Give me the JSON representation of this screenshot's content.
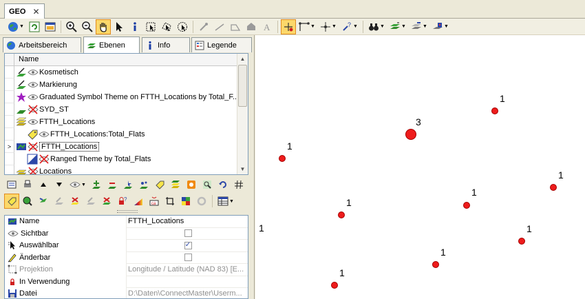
{
  "window": {
    "tab_title": "GEO",
    "close_glyph": "✕"
  },
  "toolbar": {
    "icons": [
      "globe-icon",
      "refresh-icon",
      "window-icon",
      "zoom-in-icon",
      "zoom-out-icon",
      "pan-hand-icon",
      "pointer-icon",
      "info-icon",
      "select-rect-icon",
      "select-polygon-icon",
      "select-radius-icon",
      "edit-node-icon",
      "line-icon",
      "rectangle-icon",
      "polygon-icon",
      "text-icon",
      "snap-icon",
      "measure-icon",
      "target-icon",
      "locate-icon",
      "binoculars-icon",
      "layer-add-icon",
      "layer-edit-icon",
      "layer-settings-icon"
    ],
    "active": "snap-icon"
  },
  "panel_tabs": [
    {
      "label": "Arbeitsbereich",
      "icon": "workspace-icon"
    },
    {
      "label": "Ebenen",
      "icon": "layers-icon",
      "selected": true
    },
    {
      "label": "Info",
      "icon": "info-icon"
    },
    {
      "label": "Legende",
      "icon": "legend-icon"
    }
  ],
  "layers": {
    "header": "Name",
    "rows": [
      {
        "label": "Kosmetisch",
        "indent": 0,
        "type": "cosmetic",
        "visible": true
      },
      {
        "label": "Markierung",
        "indent": 0,
        "type": "cosmetic",
        "visible": true
      },
      {
        "label": "Graduated Symbol Theme on FTTH_Locations by Total_F...",
        "indent": 0,
        "type": "theme-star",
        "visible": true
      },
      {
        "label": "SYD_ST",
        "indent": 0,
        "type": "region",
        "visible": false
      },
      {
        "label": "FTTH_Locations",
        "indent": 0,
        "type": "stack",
        "visible": true
      },
      {
        "label": "FTTH_Locations:Total_Flats",
        "indent": 1,
        "type": "label-tag",
        "visible": true
      },
      {
        "label": "FTTH_Locations",
        "indent": 0,
        "type": "table",
        "visible": false,
        "selected": true,
        "marker": ">"
      },
      {
        "label": "Ranged Theme by Total_Flats",
        "indent": 1,
        "type": "ranged",
        "visible": false
      },
      {
        "label": "Locations",
        "indent": 0,
        "type": "stack",
        "visible": false
      }
    ]
  },
  "properties": [
    {
      "key": "Name",
      "value": "FTTH_Locations",
      "icon": "layer-icon",
      "kind": "text"
    },
    {
      "key": "Sichtbar",
      "value": "",
      "icon": "eye-icon",
      "kind": "checkbox",
      "checked": false
    },
    {
      "key": "Auswählbar",
      "value": "",
      "icon": "select-arrow-icon",
      "kind": "checkbox",
      "checked": true
    },
    {
      "key": "Änderbar",
      "value": "",
      "icon": "pencil-icon",
      "kind": "checkbox",
      "checked": false
    },
    {
      "key": "Projektion",
      "value": "Longitude / Latitude (NAD 83) [E...",
      "icon": "projection-icon",
      "kind": "text",
      "disabled": true
    },
    {
      "key": "In Verwendung",
      "value": "",
      "icon": "lock-icon",
      "kind": "text"
    },
    {
      "key": "Datei",
      "value": "D:\\Daten\\ConnectMaster\\Userm...",
      "icon": "save-icon",
      "kind": "text",
      "disabled": true
    }
  ],
  "map": {
    "points": [
      {
        "label": "1"
      },
      {
        "label": "3"
      },
      {
        "label": "1"
      },
      {
        "label": "1"
      },
      {
        "label": "1"
      },
      {
        "label": "1"
      },
      {
        "label": "1"
      },
      {
        "label": "1"
      },
      {
        "label": "1"
      }
    ],
    "stray_label": "1",
    "point_color": "#ee1c1c"
  }
}
